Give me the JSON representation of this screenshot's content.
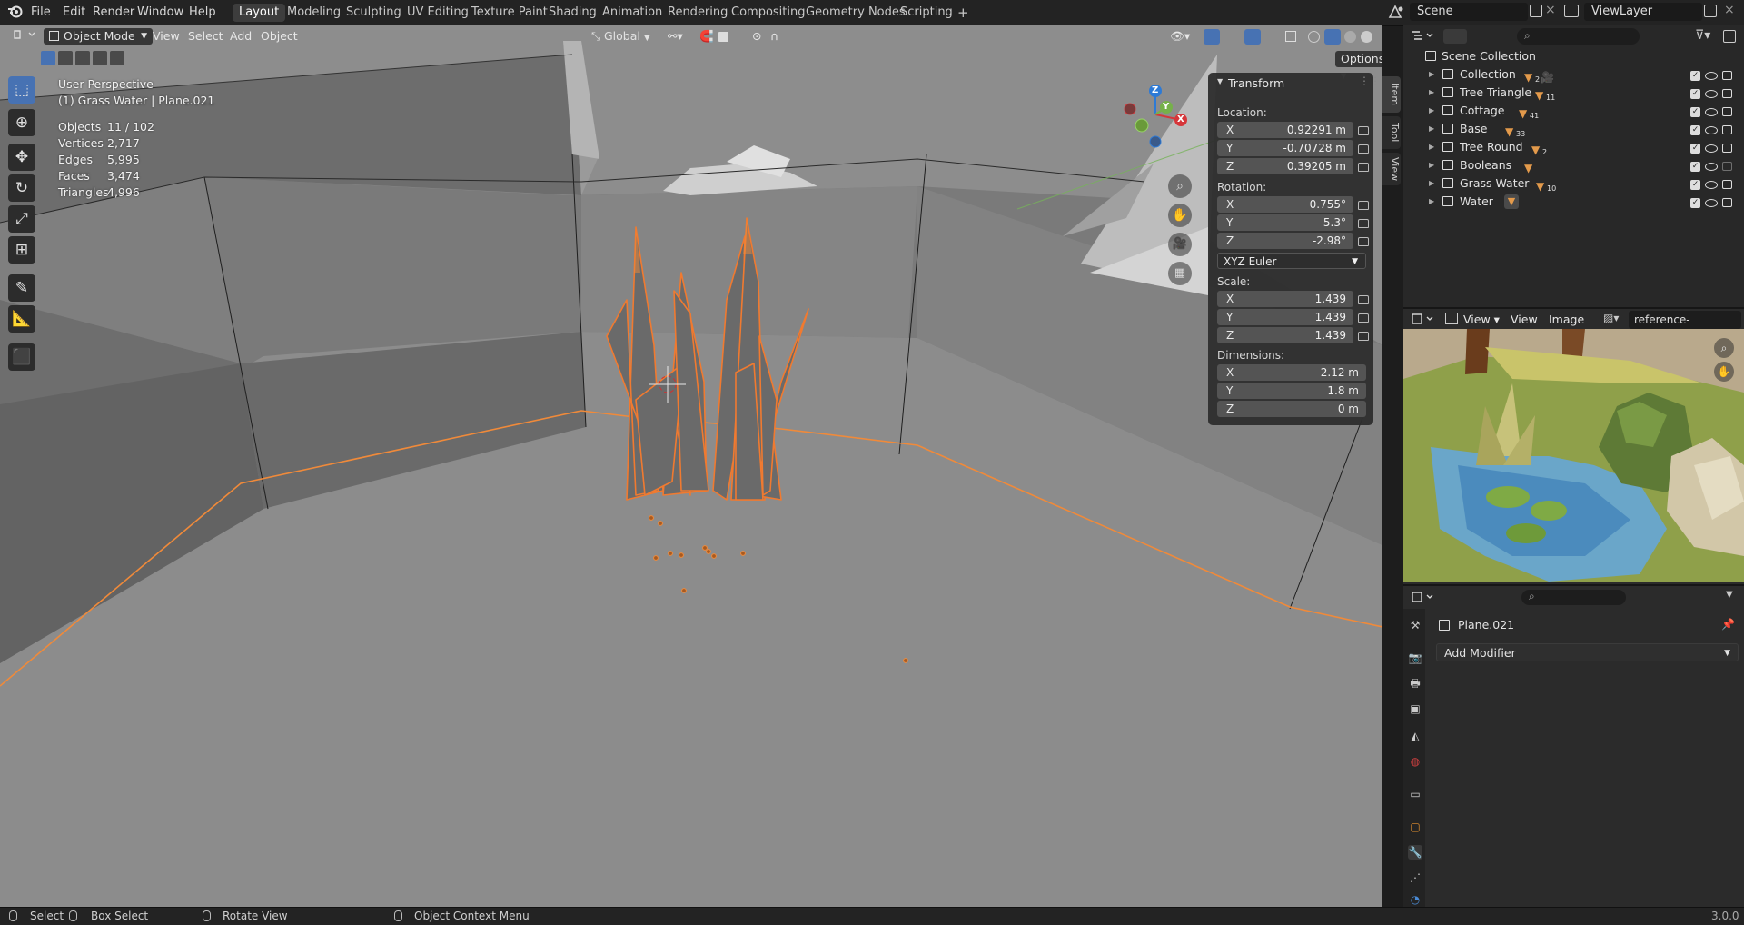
{
  "menu": {
    "file": "File",
    "edit": "Edit",
    "render": "Render",
    "window": "Window",
    "help": "Help"
  },
  "workspaces": [
    {
      "label": "Layout",
      "active": true
    },
    {
      "label": "Modeling"
    },
    {
      "label": "Sculpting"
    },
    {
      "label": "UV Editing"
    },
    {
      "label": "Texture Paint"
    },
    {
      "label": "Shading"
    },
    {
      "label": "Animation"
    },
    {
      "label": "Rendering"
    },
    {
      "label": "Compositing"
    },
    {
      "label": "Geometry Nodes"
    },
    {
      "label": "Scripting"
    }
  ],
  "add_workspace": "+",
  "scene": {
    "name": "Scene",
    "view_layer": "ViewLayer"
  },
  "viewport_header": {
    "mode": "Object Mode",
    "view": "View",
    "select": "Select",
    "add": "Add",
    "object": "Object",
    "orientation": "Global",
    "options": "Options"
  },
  "overlay_info": {
    "perspective": "User Perspective",
    "active": "(1) Grass Water | Plane.021",
    "stats": [
      {
        "label": "Objects",
        "value": "11 / 102"
      },
      {
        "label": "Vertices",
        "value": "2,717"
      },
      {
        "label": "Edges",
        "value": "5,995"
      },
      {
        "label": "Faces",
        "value": "3,474"
      },
      {
        "label": "Triangles",
        "value": "4,996"
      }
    ]
  },
  "gizmo": {
    "x": "X",
    "y": "Y",
    "z": "Z"
  },
  "transform": {
    "title": "Transform",
    "location_label": "Location:",
    "location": [
      {
        "axis": "X",
        "value": "0.92291 m"
      },
      {
        "axis": "Y",
        "value": "-0.70728 m"
      },
      {
        "axis": "Z",
        "value": "0.39205 m"
      }
    ],
    "rotation_label": "Rotation:",
    "rotation": [
      {
        "axis": "X",
        "value": "0.755°"
      },
      {
        "axis": "Y",
        "value": "5.3°"
      },
      {
        "axis": "Z",
        "value": "-2.98°"
      }
    ],
    "rotation_mode": "XYZ Euler",
    "scale_label": "Scale:",
    "scale": [
      {
        "axis": "X",
        "value": "1.439"
      },
      {
        "axis": "Y",
        "value": "1.439"
      },
      {
        "axis": "Z",
        "value": "1.439"
      }
    ],
    "dimensions_label": "Dimensions:",
    "dimensions": [
      {
        "axis": "X",
        "value": "2.12 m"
      },
      {
        "axis": "Y",
        "value": "1.8 m"
      },
      {
        "axis": "Z",
        "value": "0 m"
      }
    ]
  },
  "side_tabs": [
    "Item",
    "Tool",
    "View"
  ],
  "outliner": {
    "root": "Scene Collection",
    "items": [
      {
        "name": "Collection",
        "count": "2"
      },
      {
        "name": "Tree Triangle",
        "count": "11"
      },
      {
        "name": "Cottage",
        "count": "41"
      },
      {
        "name": "Base",
        "count": "33"
      },
      {
        "name": "Tree Round",
        "count": "2"
      },
      {
        "name": "Booleans",
        "count": ""
      },
      {
        "name": "Grass Water",
        "count": "10"
      },
      {
        "name": "Water",
        "count": ""
      }
    ]
  },
  "image_editor": {
    "view": "View",
    "view2": "View",
    "image": "Image",
    "filename": "reference-image.png"
  },
  "properties": {
    "object_name": "Plane.021",
    "add_modifier": "Add Modifier"
  },
  "statusbar": {
    "select": "Select",
    "box_select": "Box Select",
    "rotate_view": "Rotate View",
    "context_menu": "Object Context Menu",
    "version": "3.0.0"
  },
  "colors": {
    "accent": "#4772b3",
    "selection": "#f08a3a",
    "viewport_bg": "#8d8d8d"
  }
}
